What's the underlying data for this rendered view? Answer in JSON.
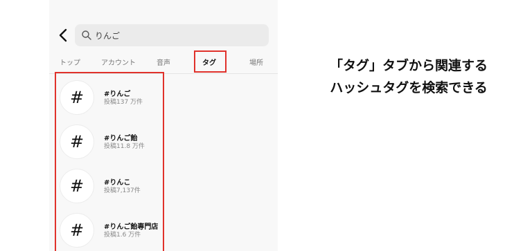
{
  "search": {
    "query": "りんご"
  },
  "tabs": [
    {
      "label": "トップ",
      "active": false
    },
    {
      "label": "アカウント",
      "active": false
    },
    {
      "label": "音声",
      "active": false
    },
    {
      "label": "タグ",
      "active": true
    },
    {
      "label": "場所",
      "active": false
    }
  ],
  "results": [
    {
      "icon": "#",
      "tag": "#りんご",
      "posts": "投稿137 万件"
    },
    {
      "icon": "#",
      "tag": "#りんご飴",
      "posts": "投稿11.8 万件"
    },
    {
      "icon": "#",
      "tag": "#りんこ",
      "posts": "投稿7,137件"
    },
    {
      "icon": "#",
      "tag": "#りんご飴専門店",
      "posts": "投稿1.6 万件"
    }
  ],
  "caption": {
    "line1": "「タグ」タブから関連する",
    "line2": "ハッシュタグを検索できる"
  },
  "colors": {
    "highlight": "#e0312b",
    "search_bg": "#ebebeb",
    "screen_bg": "#f8f8f8"
  }
}
